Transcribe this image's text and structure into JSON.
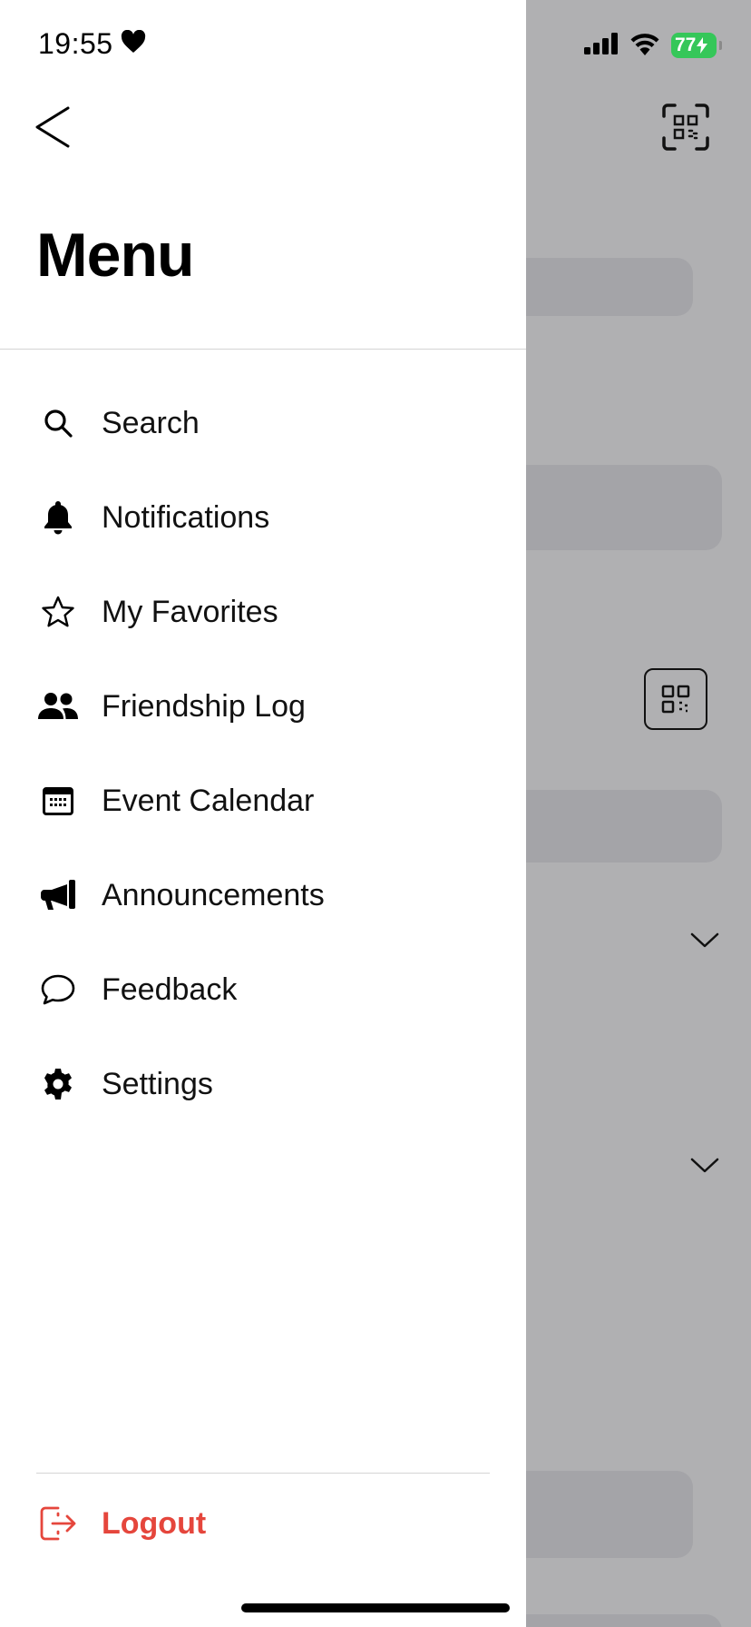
{
  "status_bar": {
    "time": "19:55",
    "battery_level": "77",
    "battery_color": "#35c759"
  },
  "drawer": {
    "title": "Menu",
    "items": [
      {
        "label": "Search",
        "icon": "search-icon"
      },
      {
        "label": "Notifications",
        "icon": "bell-icon"
      },
      {
        "label": "My Favorites",
        "icon": "star-icon"
      },
      {
        "label": "Friendship Log",
        "icon": "people-icon"
      },
      {
        "label": "Event Calendar",
        "icon": "calendar-icon"
      },
      {
        "label": "Announcements",
        "icon": "megaphone-icon"
      },
      {
        "label": "Feedback",
        "icon": "speech-bubble-icon"
      },
      {
        "label": "Settings",
        "icon": "gear-icon"
      }
    ],
    "logout": {
      "label": "Logout",
      "icon": "logout-icon",
      "color": "#e5463c"
    }
  },
  "background": {
    "overlay_color": "#b0b0b2"
  }
}
